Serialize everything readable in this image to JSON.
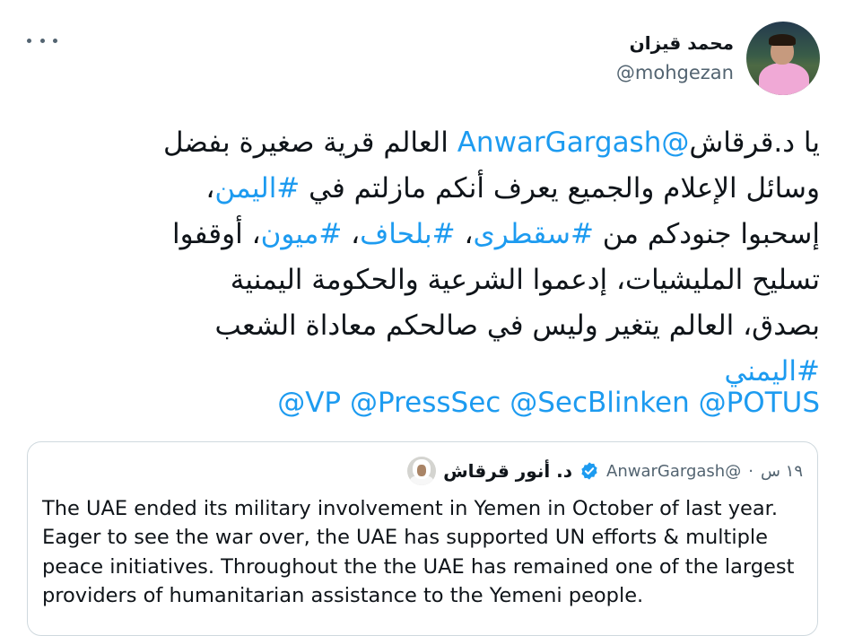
{
  "author": {
    "display_name": "محمد قيزان",
    "handle": "@mohgezan"
  },
  "tweet": {
    "segments": [
      {
        "text": "يا د.قرقاش",
        "link": false
      },
      {
        "text": "@AnwarGargash",
        "link": true
      },
      {
        "text": " العالم قرية صغيرة بفضل\nوسائل الإعلام والجميع يعرف أنكم مازلتم في ",
        "link": false
      },
      {
        "text": "#اليمن",
        "link": true
      },
      {
        "text": "،\nإسحبوا جنودكم من ",
        "link": false
      },
      {
        "text": "#سقطرى",
        "link": true
      },
      {
        "text": "، ",
        "link": false
      },
      {
        "text": "#بلحاف",
        "link": true
      },
      {
        "text": "، ",
        "link": false
      },
      {
        "text": "#ميون",
        "link": true
      },
      {
        "text": "، أوقفوا\nتسليح المليشيات، إدعموا الشرعية والحكومة اليمنية\nبصدق، العالم يتغير وليس في صالحكم معاداة الشعب\n",
        "link": false
      },
      {
        "text": "#اليمني",
        "link": true
      }
    ],
    "mentions": [
      "@POTUS",
      "@SecBlinken",
      "@PressSec",
      "@VP"
    ]
  },
  "quote": {
    "display_name": "د. أنور قرقاش",
    "handle": "@AnwarGargash",
    "separator": "·",
    "time": "١٩ س",
    "text": "The UAE ended its military involvement in Yemen in October of last year. Eager to see the war over, the UAE has supported UN efforts & multiple peace initiatives. Throughout the the UAE has remained one of the largest providers of humanitarian assistance to the Yemeni people."
  },
  "icons": {
    "more": "more-horizontal-icon",
    "verified": "verified-badge-icon"
  },
  "colors": {
    "link": "#1d9bf0",
    "text": "#0f1419",
    "secondary": "#536471",
    "border": "#cfd9de"
  }
}
